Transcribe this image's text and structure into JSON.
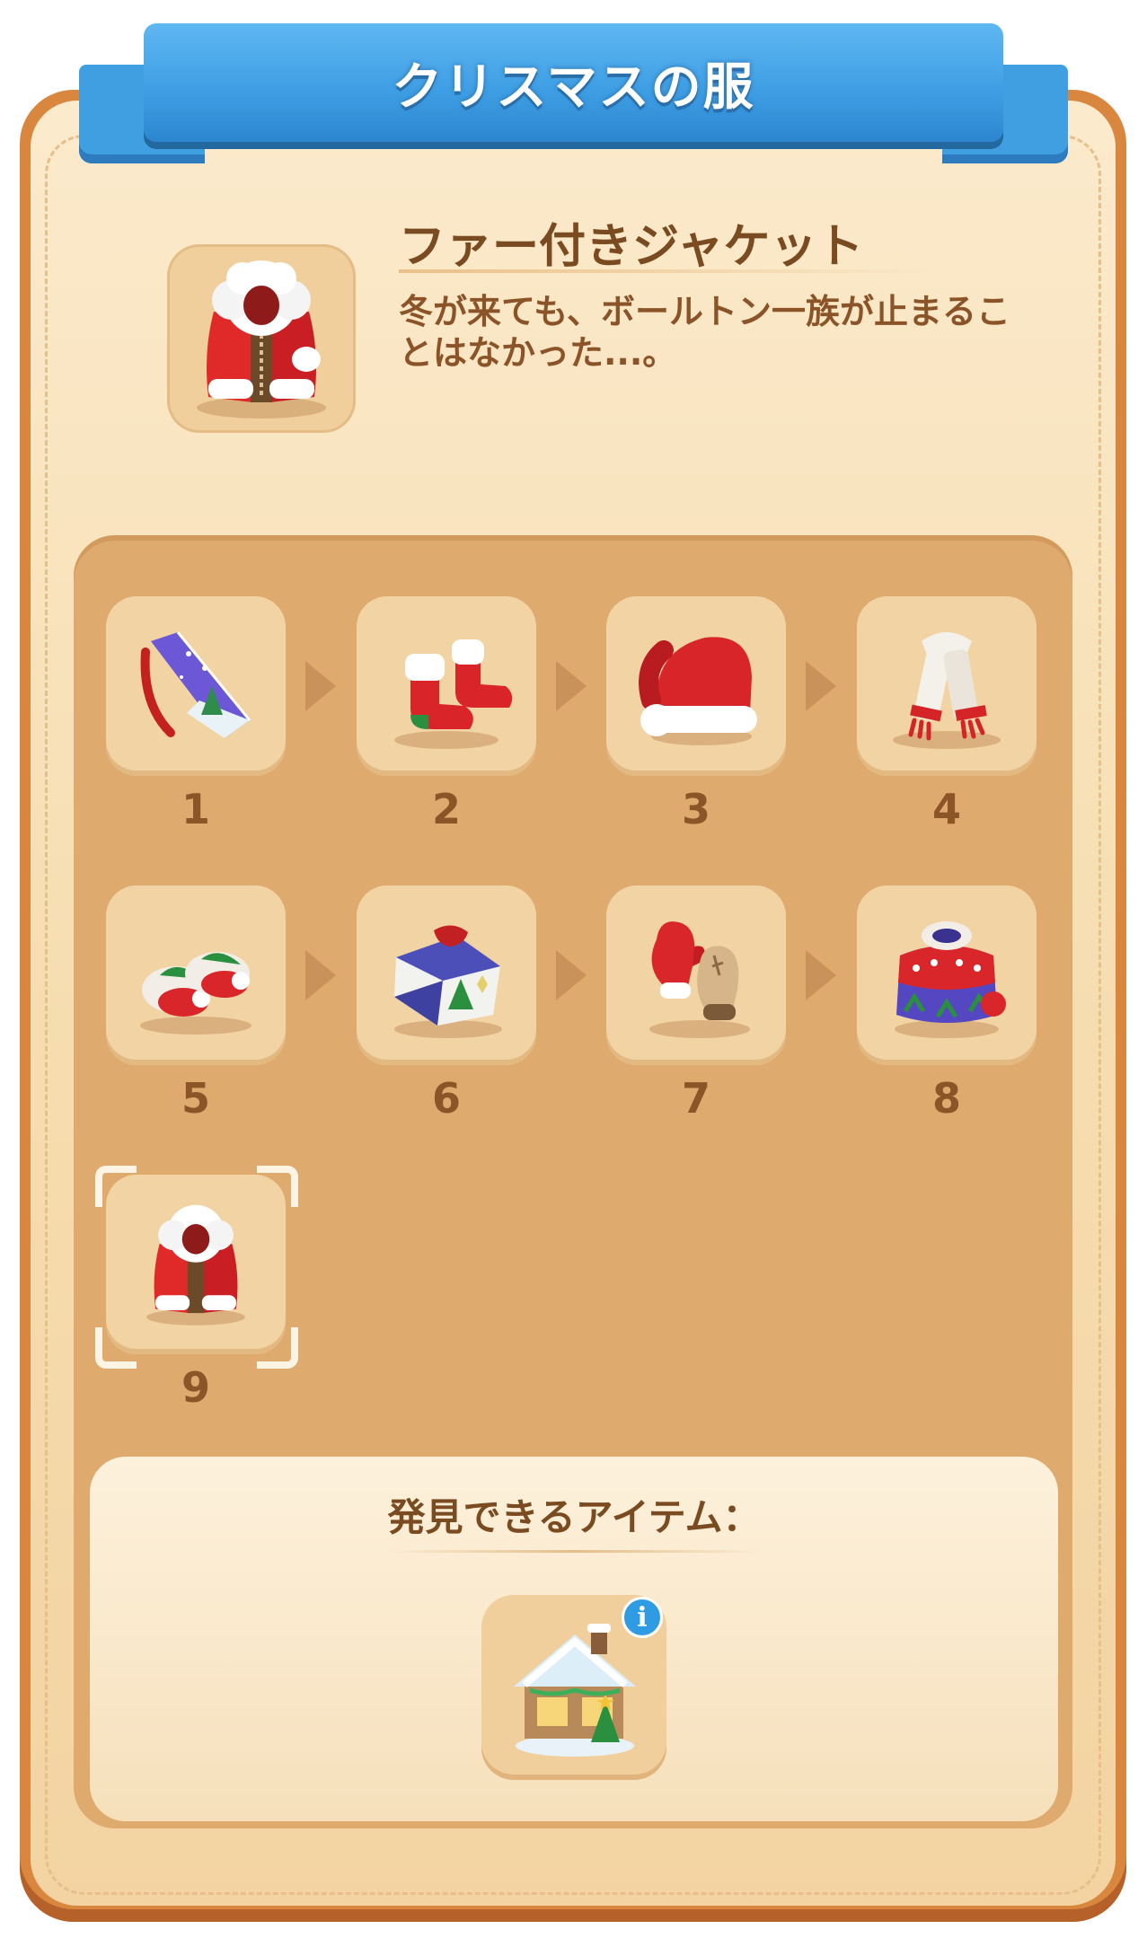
{
  "title": "クリスマスの服",
  "featured_item": {
    "name": "ファー付きジャケット",
    "description": "冬が来ても、ボールトン一族が止まることはなかった...。",
    "icon": "fur-jacket-icon"
  },
  "merge_chain": [
    {
      "number": "1",
      "icon": "christmas-card-icon"
    },
    {
      "number": "2",
      "icon": "christmas-socks-icon"
    },
    {
      "number": "3",
      "icon": "santa-hat-icon"
    },
    {
      "number": "4",
      "icon": "knit-scarf-icon"
    },
    {
      "number": "5",
      "icon": "slippers-icon"
    },
    {
      "number": "6",
      "icon": "christmas-sweater-icon"
    },
    {
      "number": "7",
      "icon": "mittens-icon"
    },
    {
      "number": "8",
      "icon": "knit-pullover-icon"
    },
    {
      "number": "9",
      "icon": "fur-jacket-icon"
    }
  ],
  "found_items": {
    "label": "発見できるアイテム：",
    "items": [
      {
        "icon": "snowy-house-icon",
        "info": "i"
      }
    ]
  },
  "colors": {
    "ribbon": "#3d9de3",
    "frame": "#d9873f",
    "panel": "#dfaa6e",
    "slot": "#f2d3a4",
    "text_brown": "#7a4b20"
  }
}
